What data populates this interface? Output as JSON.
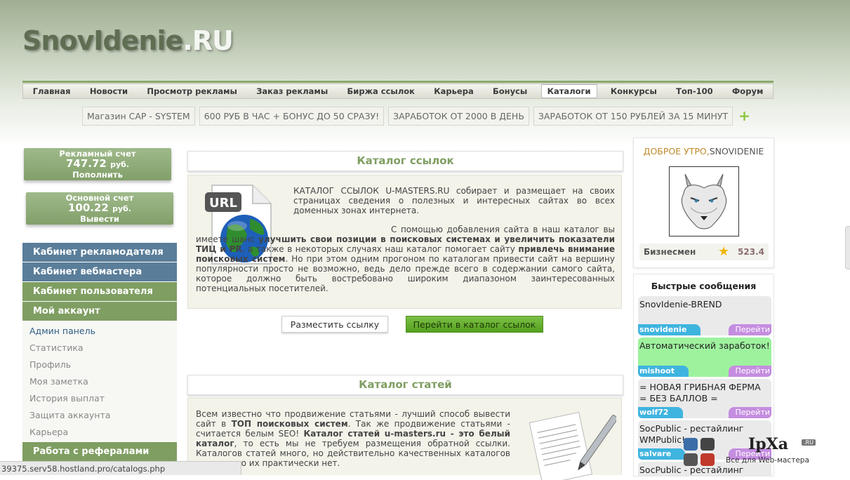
{
  "logo": {
    "part1": "SnovIdenie",
    "part2": ".RU"
  },
  "nav": [
    "Главная",
    "Новости",
    "Просмотр рекламы",
    "Заказ рекламы",
    "Биржа ссылок",
    "Карьера",
    "Бонусы",
    "Каталоги",
    "Конкурсы",
    "Топ-100",
    "Форум"
  ],
  "nav_active": "Каталоги",
  "ads": [
    "Магазин CAP - SYSTEM",
    "600 РУБ В ЧАС + БОНУС ДО 50 СРАЗУ!",
    "ЗАРАБОТОК ОТ 2000 В ДЕНЬ",
    "ЗАРАБОТОК ОТ 150 РУБЛЕЙ ЗА 15 МИНУТ"
  ],
  "ads_add": "+",
  "accounts": {
    "ad": {
      "title": "Рекламный счет",
      "amount": "747.72",
      "currency": "руб.",
      "action": "Пополнить"
    },
    "main": {
      "title": "Основной счет",
      "amount": "100.22",
      "currency": "руб.",
      "action": "Вывести"
    }
  },
  "menu": {
    "cab_adv": "Кабинет рекламодателя",
    "cab_web": "Кабинет вебмастера",
    "cab_user": "Кабинет пользователя",
    "my_account": "Мой аккаунт",
    "sub": [
      "Админ панель",
      "Статистика",
      "Профиль",
      "Моя заметка",
      "История выплат",
      "Защита аккаунта",
      "Карьера"
    ],
    "referrals": "Работа с рефералами"
  },
  "catalog_links": {
    "title": "Каталог ссылок",
    "icon_label": "URL",
    "p1": "КАТАЛОГ ССЫЛОК U-MASTERS.RU собирает и размещает на своих страницах сведения о полезных и интересных сайтах во всех доменных зонах интернета.",
    "p2_a": "С помощью добавления сайта в наш каталог вы имеете шанс ",
    "p2_b": "улучшить свои позиции в поисковых системах и увеличить показатели ТИЦ и PR",
    "p2_c": ", а также в некоторых случаях наш каталог помогает сайту ",
    "p2_d": "привлечь внимание поисковых систем",
    "p2_e": ". Но при этом одним прогоном по каталогам привести сайт на вершину популярности просто не возможно, ведь дело прежде всего в содержании самого сайта, которое должно быть востребовано широким диапазоном заинтересованных потенциальных посетителей.",
    "btn_place": "Разместить ссылку",
    "btn_go": "Перейти в каталог ссылок"
  },
  "catalog_articles": {
    "title": "Каталог статей",
    "t1": "Всем известно что продвижение статьями - лучший способ вывести сайт в ",
    "t2": "ТОП поисковых систем",
    "t3": ". Так же продвижение статьями - считается белым SEO! ",
    "t4": "Каталог статей u-masters.ru - это белый каталог",
    "t5": ", то есть мы не требуем размещения обратной ссылки. Каталогов статей много, но действительно качественных каталогов очень мало их практически нет."
  },
  "profile": {
    "greeting": "ДОБРОЕ УТРО,",
    "username": "SNOVIDENIE",
    "rank": "Бизнесмен",
    "score": "523.4"
  },
  "quick": {
    "title": "Быстрые сообщения",
    "go_label": "Перейти",
    "messages": [
      {
        "text": "SnovIdenie-BREND",
        "user": "snovidenie",
        "bg": "#eaeaea"
      },
      {
        "text": "Автоматический заработок!",
        "user": "mishoot",
        "bg": "#9ef29e"
      },
      {
        "text": "= НОВАЯ ГРИБНАЯ ФЕРМА = БЕЗ БАЛЛОВ =",
        "user": "wolf72",
        "bg": "#eaeaea"
      },
      {
        "text": "SocPublic - рестайлинг WMPublic!",
        "user": "salvare",
        "bg": "#eaeaea"
      },
      {
        "text": "SocPublic - рестайлинг",
        "user": "",
        "bg": "#eaeaea"
      }
    ]
  },
  "status_url": "39375.serv58.hostland.pro/catalogs.php",
  "ipxa": {
    "name": "IpXa",
    "ru": ".RU",
    "tagline": "Все для Web-мастера"
  },
  "colors": {
    "accent_green": "#7f9e62",
    "menu_blue": "#5a7d99",
    "go_button": "#55a11e"
  }
}
